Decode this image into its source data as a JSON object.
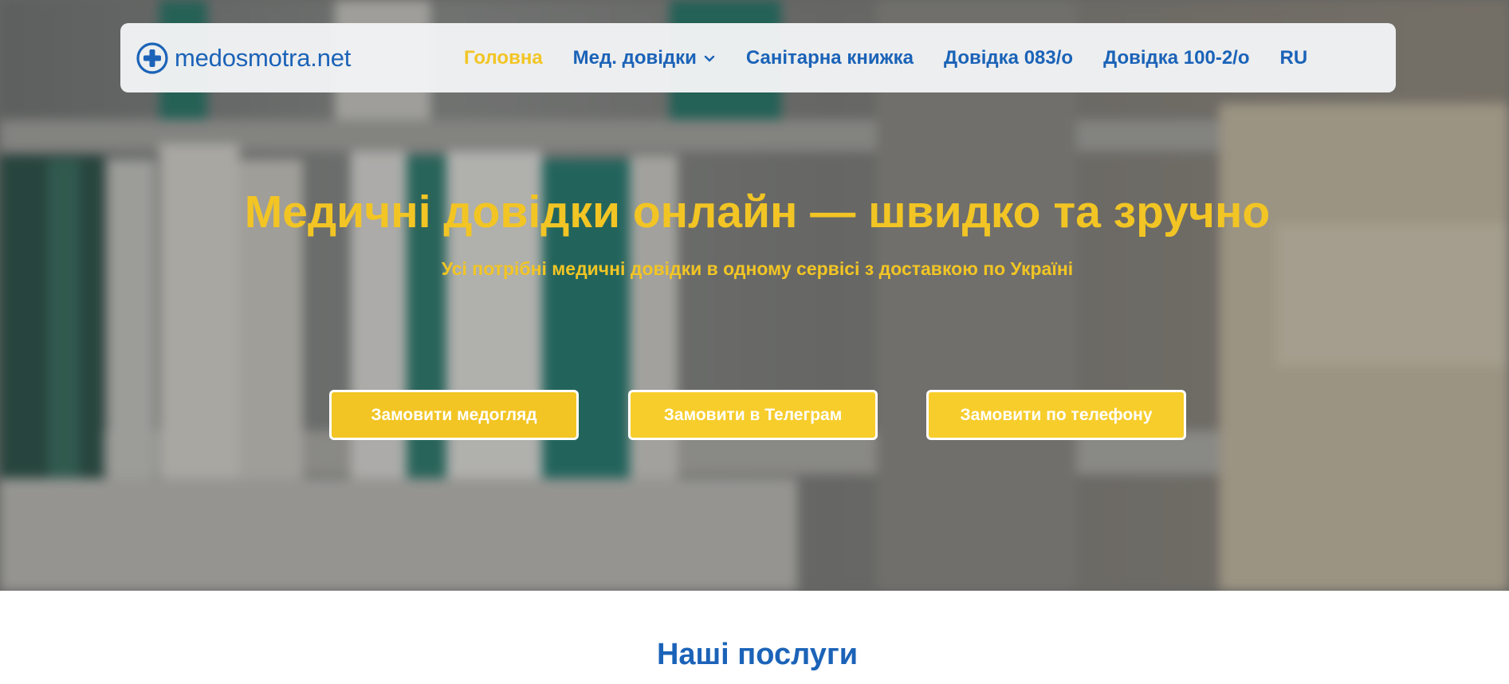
{
  "brand": {
    "name": "medosmotra.net",
    "primary_color": "#1b63b8",
    "accent_color": "#f2c524",
    "logo_icon": "medical-cross-icon"
  },
  "nav": {
    "items": [
      {
        "label": "Головна",
        "active": true
      },
      {
        "label": "Мед. довідки",
        "has_dropdown": true
      },
      {
        "label": "Санітарна книжка"
      },
      {
        "label": "Довідка 083/о"
      },
      {
        "label": "Довідка 100-2/о"
      },
      {
        "label": "RU"
      }
    ]
  },
  "hero": {
    "title": "Медичні довідки онлайн — швидко та зручно",
    "subtitle": "Усі потрібні медичні довідки в одному сервісі з доставкою по Україні",
    "buttons": [
      {
        "label": "Замовити медогляд"
      },
      {
        "label": "Замовити в Телеграм"
      },
      {
        "label": "Замовити по телефону"
      }
    ]
  },
  "services": {
    "title": "Наші послуги"
  }
}
